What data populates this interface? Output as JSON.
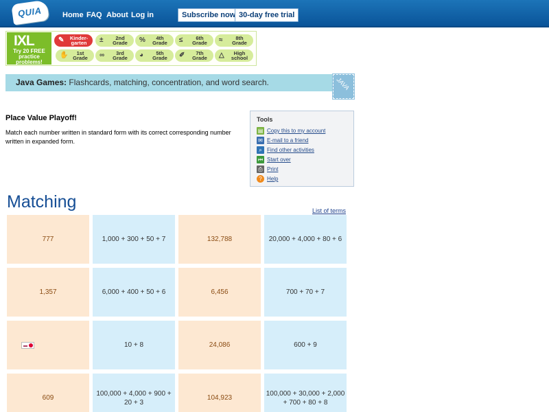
{
  "nav": {
    "logo_text": "QUIA",
    "links": [
      "Home",
      "FAQ",
      "About",
      "Log in"
    ],
    "subscribe_label": "Subscribe now",
    "trial_label": "30-day free trial"
  },
  "ixl": {
    "logo_text": "IXL",
    "tagline": "Try 20 FREE practice problems!",
    "grades": [
      {
        "label": "Kinder-garten",
        "icon": "pencil-icon"
      },
      {
        "label": "2nd Grade",
        "icon": "plus-minus-icon"
      },
      {
        "label": "4th Grade",
        "icon": "percent-icon"
      },
      {
        "label": "6th Grade",
        "icon": "less-equal-icon"
      },
      {
        "label": "8th Grade",
        "icon": "approx-icon"
      },
      {
        "label": "1st Grade",
        "icon": "hand-icon"
      },
      {
        "label": "3rd Grade",
        "icon": "infinity-icon"
      },
      {
        "label": "5th Grade",
        "icon": "pie-icon"
      },
      {
        "label": "7th Grade",
        "icon": "ruler-icon"
      },
      {
        "label": "High school",
        "icon": "triangle-icon"
      }
    ]
  },
  "javabar": {
    "bold": "Java Games:",
    "rest": " Flashcards, matching, concentration, and word search.",
    "icon_text": "JAVA"
  },
  "activity": {
    "title": "Place Value Playoff!",
    "description": "Match each number written in standard form with its correct corresponding number written in expanded form."
  },
  "tools": {
    "header": "Tools",
    "items": [
      {
        "label": "Copy this to my account",
        "icon": "copy-icon",
        "color": "#7cb342"
      },
      {
        "label": "E-mail to a friend",
        "icon": "email-icon",
        "color": "#3a6fb0"
      },
      {
        "label": "Find other activities",
        "icon": "search-icon",
        "color": "#2f74b5"
      },
      {
        "label": "Start over",
        "icon": "rewind-icon",
        "color": "#3d9a3d"
      },
      {
        "label": "Print",
        "icon": "print-icon",
        "color": "#666666"
      },
      {
        "label": "Help",
        "icon": "help-icon",
        "color": "#f08a1c"
      }
    ]
  },
  "matching": {
    "title": "Matching",
    "terms_link": "List of terms",
    "rows": [
      [
        "777",
        "1,000 + 300 + 50 + 7",
        "132,788",
        "20,000 + 4,000 + 80 + 6"
      ],
      [
        "1,357",
        "6,000 + 400 + 50 + 6",
        "6,456",
        "700 + 70 + 7"
      ],
      [
        "",
        "10 + 8",
        "24,086",
        "600 + 9"
      ],
      [
        "609",
        "100,000 + 4,000 + 900 + 20 + 3",
        "104,923",
        "100,000 + 30,000 + 2,000 + 700 + 80 + 8"
      ]
    ]
  }
}
